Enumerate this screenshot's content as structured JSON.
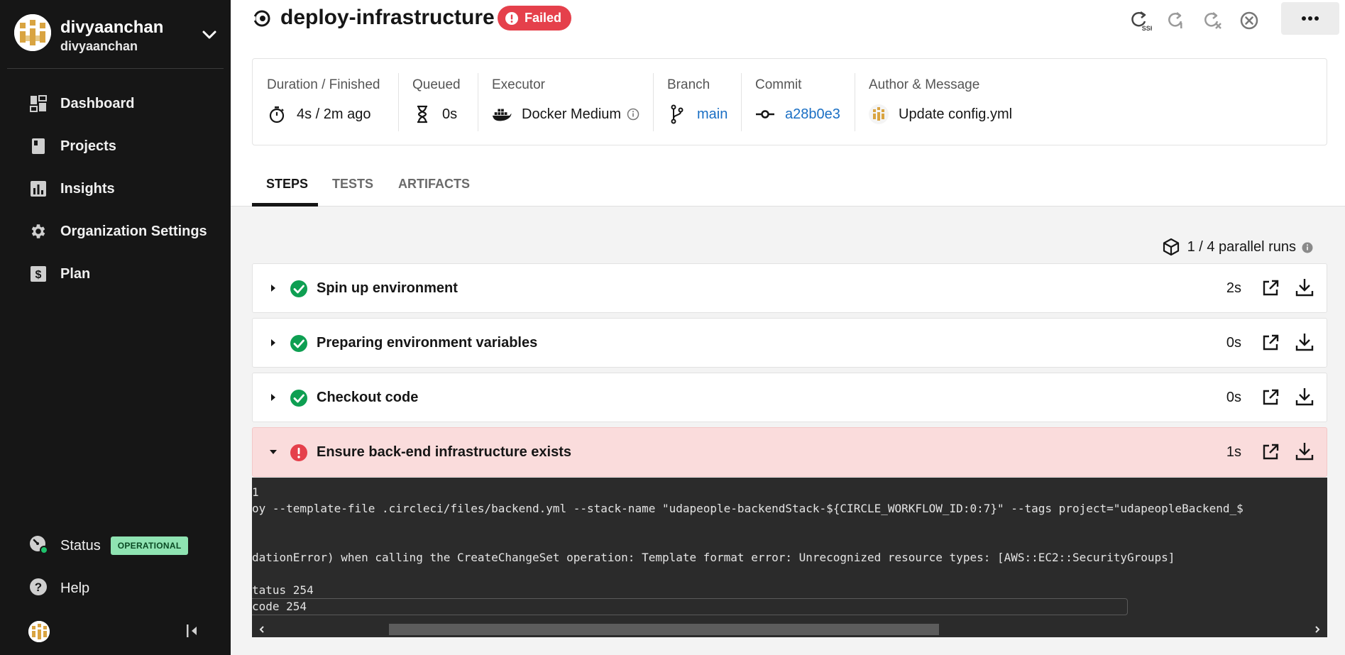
{
  "sidebar": {
    "org_name": "divyaanchan",
    "org_sub": "divyaanchan",
    "items": [
      {
        "label": "Dashboard",
        "icon": "dashboard-icon"
      },
      {
        "label": "Projects",
        "icon": "projects-icon"
      },
      {
        "label": "Insights",
        "icon": "insights-icon"
      },
      {
        "label": "Organization Settings",
        "icon": "gear-icon"
      },
      {
        "label": "Plan",
        "icon": "dollar-icon"
      }
    ],
    "status_label": "Status",
    "status_badge": "OPERATIONAL",
    "help_label": "Help"
  },
  "header": {
    "title": "deploy-infrastructure",
    "status": "Failed",
    "ssh_label": "SSH"
  },
  "summary": {
    "duration": {
      "label": "Duration / Finished",
      "value": "4s / 2m ago"
    },
    "queued": {
      "label": "Queued",
      "value": "0s"
    },
    "executor": {
      "label": "Executor",
      "value": "Docker Medium"
    },
    "branch": {
      "label": "Branch",
      "value": "main"
    },
    "commit": {
      "label": "Commit",
      "value": "a28b0e3"
    },
    "author": {
      "label": "Author & Message",
      "value": "Update config.yml"
    }
  },
  "tabs": [
    {
      "label": "STEPS",
      "active": true
    },
    {
      "label": "TESTS",
      "active": false
    },
    {
      "label": "ARTIFACTS",
      "active": false
    }
  ],
  "parallel_runs": "1 / 4 parallel runs",
  "steps": [
    {
      "name": "Spin up environment",
      "duration": "2s",
      "status": "success"
    },
    {
      "name": "Preparing environment variables",
      "duration": "0s",
      "status": "success"
    },
    {
      "name": "Checkout code",
      "duration": "0s",
      "status": "success"
    },
    {
      "name": "Ensure back-end infrastructure exists",
      "duration": "1s",
      "status": "failed"
    }
  ],
  "terminal": {
    "lines": [
      "1",
      "oy --template-file .circleci/files/backend.yml --stack-name \"udapeople-backendStack-${CIRCLE_WORKFLOW_ID:0:7}\" --tags project=\"udapeopleBackend_$",
      "",
      "dationError) when calling the CreateChangeSet operation: Template format error: Unrecognized resource types: [AWS::EC2::SecurityGroups]",
      "",
      "tatus 254",
      "code 254"
    ]
  },
  "colors": {
    "sidebar_bg": "#161616",
    "failed": "#e5404b",
    "success": "#0e9f52",
    "link": "#1a6fc4",
    "failed_row_bg": "#fadcdc",
    "operational": "#8fe3b2"
  }
}
